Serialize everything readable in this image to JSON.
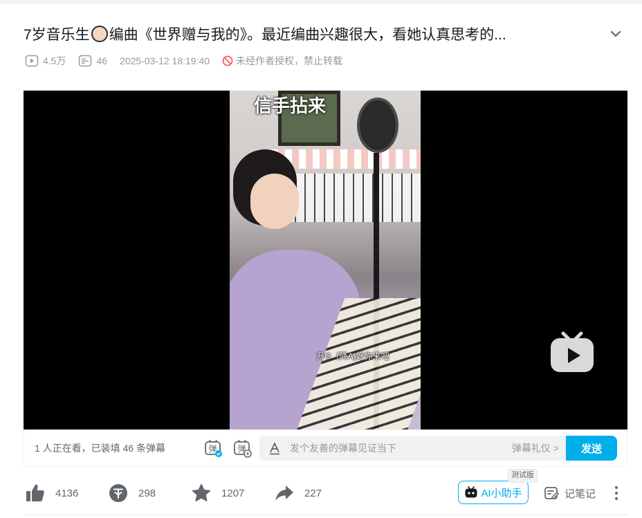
{
  "video": {
    "title_before_emoji": "7岁音乐生",
    "title_after_emoji": "编曲《世界赠与我的》。最近编曲兴趣很大，看她认真思考的...",
    "views": "4.5万",
    "danmaku_count": "46",
    "publish_time": "2025-03-12 18:19:40",
    "copyright_notice": "未经作者授权，禁止转载"
  },
  "player": {
    "subtitle_top": "信手拈来",
    "subtitle_mid": "升G（降A)好你来吧"
  },
  "danmaku_bar": {
    "watching_text": "1 人正在看，已装填 46 条弹幕",
    "input_placeholder": "发个友善的弹幕见证当下",
    "etiquette_label": "弹幕礼仪 >",
    "send_label": "发送"
  },
  "actions": {
    "like_count": "4136",
    "coin_count": "298",
    "favorite_count": "1207",
    "share_count": "227",
    "ai_label": "AI小助手",
    "ai_badge": "测试版",
    "note_label": "记笔记"
  },
  "icons": [
    "play-count-icon",
    "danmaku-count-icon",
    "no-repost-icon",
    "chevron-down-icon",
    "danmaku-toggle-icon",
    "danmaku-settings-icon",
    "text-a-icon",
    "bilibili-tv-icon",
    "like-icon",
    "coin-icon",
    "favorite-icon",
    "share-icon",
    "ai-robot-icon",
    "note-icon",
    "more-icon"
  ],
  "colors": {
    "accent": "#00aeec",
    "text": "#18191c",
    "muted": "#9499a0",
    "warn": "#f85a54"
  }
}
